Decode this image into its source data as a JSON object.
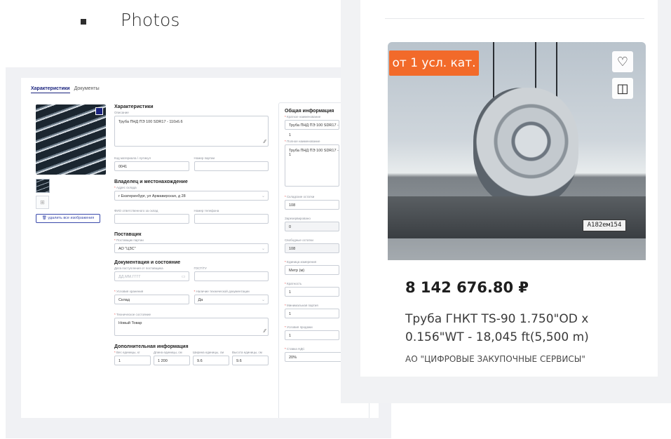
{
  "heading": "Photos",
  "form": {
    "tabs": [
      "Характеристики",
      "Документы"
    ],
    "delete_images": "удалить все изображения",
    "characteristics": {
      "title": "Характеристики",
      "description_label": "Описание",
      "description_value": "Труба ПНД ПЭ 100 SDR17 - 110х6.6",
      "material_code_label": "Код материала / Артикул",
      "material_code_value": "0041",
      "batch_number_label": "Номер партии",
      "batch_number_value": ""
    },
    "owner": {
      "title": "Владелец и местонахождение",
      "warehouse_address_label": "Адрес склада",
      "warehouse_address_value": "г Екатеринбург, ул Армавирская, д 28",
      "responsible_label": "ФИО ответственного за склад",
      "phone_label": "Номер телефона"
    },
    "supplier": {
      "title": "Поставщик",
      "supplier_label": "Поставщик партии",
      "supplier_value": "АО \"ЦЗС\""
    },
    "docs": {
      "title": "Документация и состояние",
      "receipt_date_label": "Дата поступления от поставщика",
      "receipt_date_placeholder": "ДД.ММ.ГГГГ",
      "gost_label": "ГОСТ/ТУ",
      "storage_label": "Условия хранения",
      "storage_value": "Склад",
      "tech_docs_label": "Наличие технической документации",
      "tech_docs_value": "Да",
      "tech_state_label": "Техническое состояние",
      "tech_state_value": "Новый Товар"
    },
    "extra": {
      "title": "Дополнительная информация",
      "weight_label": "Вес единицы, кг",
      "weight_value": "1",
      "length_label": "Длина единицы, см",
      "length_value": "1 200",
      "width_label": "Ширина единицы, см",
      "width_value": "9.6",
      "height_label": "Высота единицы, см",
      "height_value": "9.6"
    },
    "general": {
      "title": "Общая информация",
      "short_name_label": "Краткое наименование",
      "short_name_value": "Труба ПНД ПЭ 100 SDR17 - 1",
      "full_name_label": "Полное наименование",
      "full_name_value": "Труба ПНД ПЭ 100 SDR17 - 1",
      "total_label": "Складские остатки",
      "total_value": "108",
      "reserved_label": "Зарезервировано",
      "reserved_value": "0",
      "free_label": "Свободные остатки",
      "free_value": "108",
      "unit_label": "Единица измерения",
      "unit_value": "Метр (м)",
      "multiplicity_label": "Кратность",
      "multiplicity_value": "1",
      "min_batch_label": "Минимальная партия",
      "min_batch_value": "1",
      "sale_terms_label": "Условия продажи",
      "sale_terms_value": "1",
      "vat_label": "Ставка НДС",
      "vat_value": "20%"
    }
  },
  "card": {
    "badge": "от 1 усл. кат.",
    "heart_icon": "heart-icon",
    "compare_icon": "compare-icon",
    "plate_text": "А182ем154",
    "price": "8 142 676.80 ₽",
    "title": "Труба ГНКТ TS-90 1.750\"OD x 0.156\"WT - 18,045 ft(5,500 m)",
    "seller": "АО \"ЦИФРОВЫЕ ЗАКУПОЧНЫЕ СЕРВИСЫ\""
  },
  "colors": {
    "accent": "#1a237e",
    "badge": "#f26a2a",
    "required": "#e53935"
  }
}
